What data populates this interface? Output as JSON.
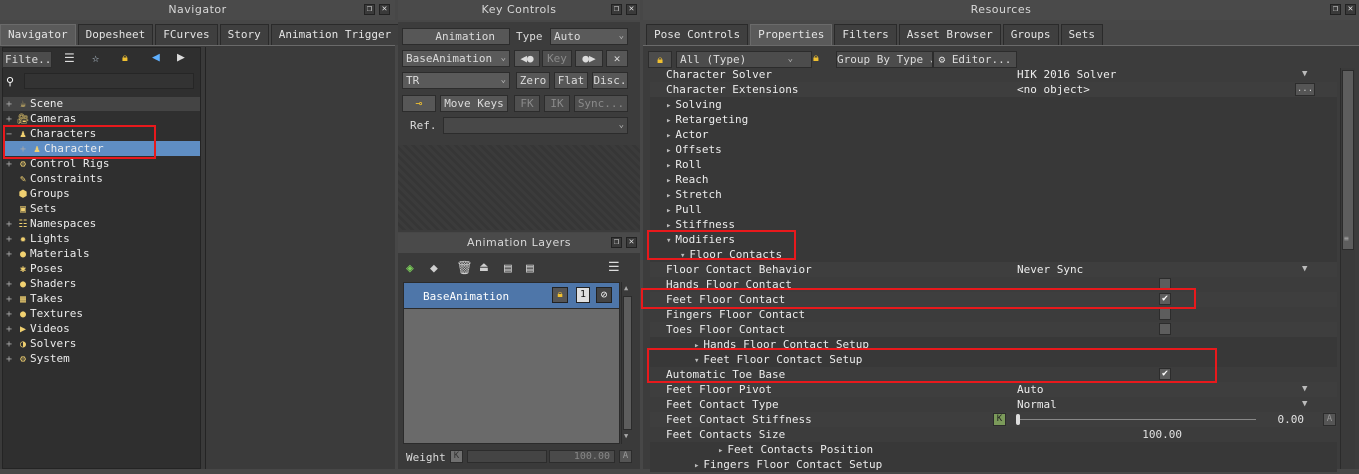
{
  "navigator": {
    "title": "Navigator",
    "tabs": [
      "Navigator",
      "Dopesheet",
      "FCurves",
      "Story",
      "Animation Trigger"
    ],
    "filter_label": "Filte...",
    "tree": [
      {
        "label": "Scene",
        "expander": "+"
      },
      {
        "label": "Cameras",
        "expander": "+"
      },
      {
        "label": "Characters",
        "expander": "−"
      },
      {
        "label": "Character",
        "expander": "+"
      },
      {
        "label": "Control Rigs",
        "expander": "+"
      },
      {
        "label": "Constraints",
        "expander": ""
      },
      {
        "label": "Groups",
        "expander": ""
      },
      {
        "label": "Sets",
        "expander": ""
      },
      {
        "label": "Namespaces",
        "expander": "+"
      },
      {
        "label": "Lights",
        "expander": "+"
      },
      {
        "label": "Materials",
        "expander": "+"
      },
      {
        "label": "Poses",
        "expander": ""
      },
      {
        "label": "Shaders",
        "expander": "+"
      },
      {
        "label": "Takes",
        "expander": "+"
      },
      {
        "label": "Textures",
        "expander": "+"
      },
      {
        "label": "Videos",
        "expander": "+"
      },
      {
        "label": "Solvers",
        "expander": "+"
      },
      {
        "label": "System",
        "expander": "+"
      }
    ]
  },
  "key_controls": {
    "title": "Key Controls",
    "animation_label": "Animation",
    "type_label": "Type",
    "type_value": "Auto",
    "base_animation": "BaseAnimation",
    "key_label": "Key",
    "tr_value": "TR",
    "zero": "Zero",
    "flat": "Flat",
    "disc": "Disc.",
    "move_keys": "Move Keys",
    "fk": "FK",
    "ik": "IK",
    "sync": "Sync...",
    "ref_label": "Ref."
  },
  "animation_layers": {
    "title": "Animation Layers",
    "layer_name": "BaseAnimation",
    "layer_number": "1",
    "weight_label": "Weight",
    "weight_key": "K",
    "weight_value": "100.00",
    "weight_anim": "A"
  },
  "resources": {
    "title": "Resources",
    "tabs": [
      "Pose Controls",
      "Properties",
      "Filters",
      "Asset Browser",
      "Groups",
      "Sets"
    ],
    "filter_value": "All (Type)",
    "group_by": "Group By Type",
    "editor": "Editor...",
    "properties": [
      {
        "label": "Character Solver",
        "value": "HIK 2016 Solver",
        "kind": "dropdown",
        "indent": 0
      },
      {
        "label": "Character Extensions",
        "value": "<no object>",
        "kind": "browse",
        "indent": 0
      },
      {
        "label": "Solving",
        "kind": "group",
        "indent": 1,
        "arrow": "▸"
      },
      {
        "label": "Retargeting",
        "kind": "group",
        "indent": 1,
        "arrow": "▸"
      },
      {
        "label": "Actor",
        "kind": "group",
        "indent": 1,
        "arrow": "▸"
      },
      {
        "label": "Offsets",
        "kind": "group",
        "indent": 1,
        "arrow": "▸"
      },
      {
        "label": "Roll",
        "kind": "group",
        "indent": 1,
        "arrow": "▸"
      },
      {
        "label": "Reach",
        "kind": "group",
        "indent": 1,
        "arrow": "▸"
      },
      {
        "label": "Stretch",
        "kind": "group",
        "indent": 1,
        "arrow": "▸"
      },
      {
        "label": "Pull",
        "kind": "group",
        "indent": 1,
        "arrow": "▸"
      },
      {
        "label": "Stiffness",
        "kind": "group",
        "indent": 1,
        "arrow": "▸"
      },
      {
        "label": "Modifiers",
        "kind": "group",
        "indent": 1,
        "arrow": "▾"
      },
      {
        "label": "Floor Contacts",
        "kind": "group",
        "indent": 2,
        "arrow": "▾"
      },
      {
        "label": "Floor Contact Behavior",
        "value": "Never Sync",
        "kind": "dropdown",
        "indent": 0
      },
      {
        "label": "Hands Floor Contact",
        "kind": "check",
        "checked": false,
        "indent": 0
      },
      {
        "label": "Feet Floor Contact",
        "kind": "check",
        "checked": true,
        "indent": 0
      },
      {
        "label": "Fingers Floor Contact",
        "kind": "check",
        "checked": false,
        "indent": 0
      },
      {
        "label": "Toes Floor Contact",
        "kind": "check",
        "checked": false,
        "indent": 0
      },
      {
        "label": "Hands Floor Contact Setup",
        "kind": "group",
        "indent": 3,
        "arrow": "▸"
      },
      {
        "label": "Feet Floor Contact Setup",
        "kind": "group",
        "indent": 3,
        "arrow": "▾"
      },
      {
        "label": "Automatic Toe Base",
        "kind": "check",
        "checked": true,
        "indent": 0
      },
      {
        "label": "Feet Floor Pivot",
        "value": "Auto",
        "kind": "dropdown",
        "indent": 0
      },
      {
        "label": "Feet Contact Type",
        "value": "Normal",
        "kind": "dropdown",
        "indent": 0
      },
      {
        "label": "Feet Contact Stiffness",
        "value": "0.00",
        "kind": "slider",
        "indent": 0,
        "key": "K",
        "anim": "A"
      },
      {
        "label": "Feet Contacts Size",
        "value": "100.00",
        "kind": "number",
        "indent": 0
      },
      {
        "label": "Feet Contacts Position",
        "kind": "group",
        "indent": 4,
        "arrow": "▸"
      },
      {
        "label": "Fingers Floor Contact Setup",
        "kind": "group",
        "indent": 3,
        "arrow": "▸"
      }
    ]
  },
  "colors": {
    "highlight_red": "#e8191c",
    "selection": "#5f8ec4"
  }
}
